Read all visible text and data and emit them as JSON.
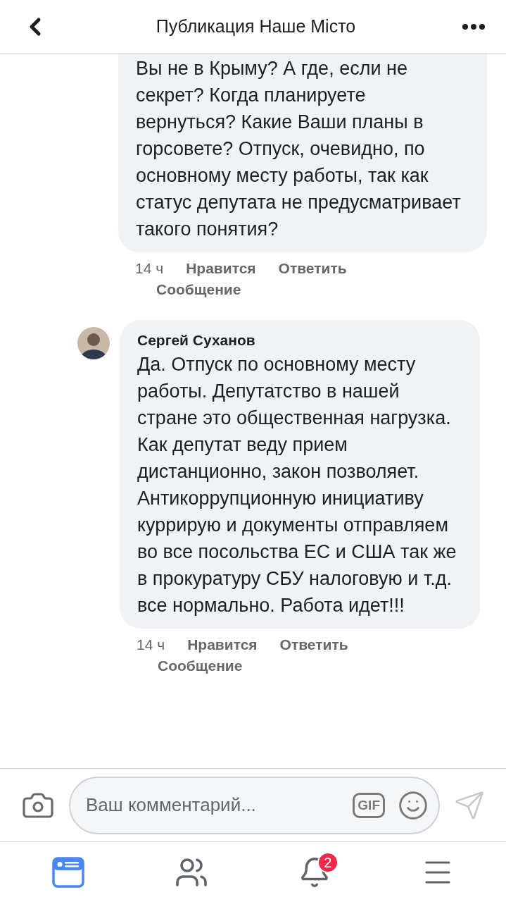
{
  "header": {
    "title": "Публикация Наше Місто"
  },
  "comments": [
    {
      "text": "Вы не в Крыму? А где, если не секрет? Когда планируете вернуться? Какие Ваши планы в горсовете? Отпуск, очевидно, по основному месту работы, так как статус депутата не предусматривает такого понятия?",
      "time": "14 ч",
      "actions": [
        "Нравится",
        "Ответить",
        "Сообщение"
      ]
    },
    {
      "author": "Сергей Суханов",
      "text": "Да. Отпуск по основному месту работы. Депутатство в  нашей стране это общественная нагрузка. Как депутат веду прием дистанционно, закон позволяет. Антикоррупционную инициативу куррирую и документы отправляем во все посольства ЕС и США так же в прокуратуру СБУ налоговую и т.д. все нормально. Работа идет!!!",
      "time": "14 ч",
      "actions": [
        "Нравится",
        "Ответить",
        "Сообщение"
      ]
    }
  ],
  "composer": {
    "placeholder": "Ваш комментарий...",
    "gif_label": "GIF"
  },
  "tab_bar": [
    {
      "kind": "feed",
      "selected": true
    },
    {
      "kind": "friends",
      "selected": false
    },
    {
      "kind": "notifications",
      "selected": false,
      "badge": "2"
    },
    {
      "kind": "menu",
      "selected": false
    }
  ]
}
